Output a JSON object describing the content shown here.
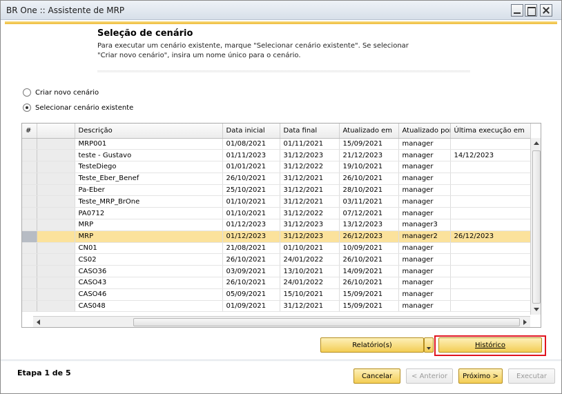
{
  "window": {
    "title": "BR One :: Assistente de MRP"
  },
  "header": {
    "title": "Seleção de cenário",
    "description_line1": "Para executar um cenário existente, marque \"Selecionar cenário existente\". Se selecionar",
    "description_line2": "\"Criar novo cenário\", insira um nome único para o cenário."
  },
  "options": {
    "create_new": {
      "label": "Criar novo cenário",
      "selected": false
    },
    "select_existing": {
      "label": "Selecionar cenário existente",
      "selected": true
    }
  },
  "table": {
    "columns": [
      "#",
      "",
      "Descrição",
      "Data inicial",
      "Data final",
      "Atualizado em",
      "Atualizado por",
      "Última execução em"
    ],
    "selected_row": 8,
    "rows": [
      {
        "descricao": "MRP001",
        "data_inicial": "01/08/2021",
        "data_final": "01/11/2021",
        "atualizado_em": "15/09/2021",
        "atualizado_por": "manager",
        "ultima_execucao": ""
      },
      {
        "descricao": "teste - Gustavo",
        "data_inicial": "01/11/2023",
        "data_final": "31/12/2023",
        "atualizado_em": "21/12/2023",
        "atualizado_por": "manager",
        "ultima_execucao": "14/12/2023"
      },
      {
        "descricao": "TesteDiego",
        "data_inicial": "01/01/2021",
        "data_final": "31/12/2022",
        "atualizado_em": "19/10/2021",
        "atualizado_por": "manager",
        "ultima_execucao": ""
      },
      {
        "descricao": "Teste_Eber_Benef",
        "data_inicial": "26/10/2021",
        "data_final": "31/12/2021",
        "atualizado_em": "26/10/2021",
        "atualizado_por": "manager",
        "ultima_execucao": ""
      },
      {
        "descricao": "Pa-Eber",
        "data_inicial": "25/10/2021",
        "data_final": "31/12/2021",
        "atualizado_em": "28/10/2021",
        "atualizado_por": "manager",
        "ultima_execucao": ""
      },
      {
        "descricao": "Teste_MRP_BrOne",
        "data_inicial": "01/10/2021",
        "data_final": "31/12/2021",
        "atualizado_em": "03/11/2021",
        "atualizado_por": "manager",
        "ultima_execucao": ""
      },
      {
        "descricao": "PA0712",
        "data_inicial": "01/10/2021",
        "data_final": "31/12/2022",
        "atualizado_em": "07/12/2021",
        "atualizado_por": "manager",
        "ultima_execucao": ""
      },
      {
        "descricao": "MRP",
        "data_inicial": "01/12/2023",
        "data_final": "31/12/2023",
        "atualizado_em": "13/12/2023",
        "atualizado_por": "manager3",
        "ultima_execucao": ""
      },
      {
        "descricao": "MRP",
        "data_inicial": "01/12/2023",
        "data_final": "31/12/2023",
        "atualizado_em": "26/12/2023",
        "atualizado_por": "manager2",
        "ultima_execucao": "26/12/2023"
      },
      {
        "descricao": "CN01",
        "data_inicial": "21/08/2021",
        "data_final": "01/10/2021",
        "atualizado_em": "10/09/2021",
        "atualizado_por": "manager",
        "ultima_execucao": ""
      },
      {
        "descricao": "CS02",
        "data_inicial": "26/10/2021",
        "data_final": "24/01/2022",
        "atualizado_em": "26/10/2021",
        "atualizado_por": "manager",
        "ultima_execucao": ""
      },
      {
        "descricao": "CASO36",
        "data_inicial": "03/09/2021",
        "data_final": "13/10/2021",
        "atualizado_em": "14/09/2021",
        "atualizado_por": "manager",
        "ultima_execucao": ""
      },
      {
        "descricao": "CASO43",
        "data_inicial": "26/10/2021",
        "data_final": "24/01/2022",
        "atualizado_em": "26/10/2021",
        "atualizado_por": "manager",
        "ultima_execucao": ""
      },
      {
        "descricao": "CASO46",
        "data_inicial": "05/09/2021",
        "data_final": "15/10/2021",
        "atualizado_em": "15/09/2021",
        "atualizado_por": "manager",
        "ultima_execucao": ""
      },
      {
        "descricao": "CAS048",
        "data_inicial": "01/09/2021",
        "data_final": "31/12/2021",
        "atualizado_em": "15/09/2021",
        "atualizado_por": "manager",
        "ultima_execucao": ""
      }
    ]
  },
  "actions": {
    "reports_label": "Relatório(s)",
    "history_label": "Histórico"
  },
  "footer": {
    "step_label": "Etapa 1 de 5",
    "cancel_label": "Cancelar",
    "previous_label": "< Anterior",
    "next_label": "Próximo >",
    "execute_label": "Executar"
  },
  "colors": {
    "accent": "#f3cd55",
    "selected_row": "#fbe29c",
    "highlight_box": "#e0141e"
  }
}
